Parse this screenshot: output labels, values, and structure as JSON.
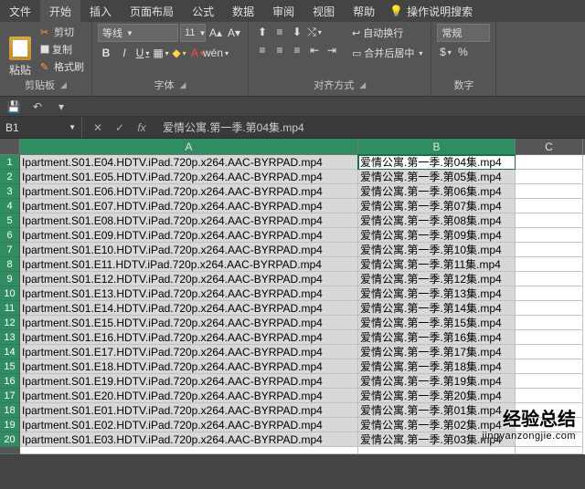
{
  "tabs": {
    "file": "文件",
    "home": "开始",
    "insert": "插入",
    "layout": "页面布局",
    "formula": "公式",
    "data": "数据",
    "review": "审阅",
    "view": "视图",
    "help": "帮助",
    "tell_me": "操作说明搜索"
  },
  "clipboard": {
    "paste": "粘贴",
    "cut": "剪切",
    "copy": "复制",
    "format_painter": "格式刷",
    "group_label": "剪贴板"
  },
  "font": {
    "name": "等线",
    "size": "11",
    "group_label": "字体",
    "wen": "wén"
  },
  "alignment": {
    "wrap": "自动换行",
    "merge": "合并后居中",
    "group_label": "对齐方式"
  },
  "number": {
    "format": "常规",
    "group_label": "数字"
  },
  "name_box": "B1",
  "formula_value": "爱情公寓.第一季.第04集.mp4",
  "columns": {
    "A": "A",
    "B": "B",
    "C": "C"
  },
  "rows": [
    {
      "n": "1",
      "a": "Ipartment.S01.E04.HDTV.iPad.720p.x264.AAC-BYRPAD.mp4",
      "b": "爱情公寓.第一季.第04集.mp4"
    },
    {
      "n": "2",
      "a": "Ipartment.S01.E05.HDTV.iPad.720p.x264.AAC-BYRPAD.mp4",
      "b": "爱情公寓.第一季.第05集.mp4"
    },
    {
      "n": "3",
      "a": "Ipartment.S01.E06.HDTV.iPad.720p.x264.AAC-BYRPAD.mp4",
      "b": "爱情公寓.第一季.第06集.mp4"
    },
    {
      "n": "4",
      "a": "Ipartment.S01.E07.HDTV.iPad.720p.x264.AAC-BYRPAD.mp4",
      "b": "爱情公寓.第一季.第07集.mp4"
    },
    {
      "n": "5",
      "a": "Ipartment.S01.E08.HDTV.iPad.720p.x264.AAC-BYRPAD.mp4",
      "b": "爱情公寓.第一季.第08集.mp4"
    },
    {
      "n": "6",
      "a": "Ipartment.S01.E09.HDTV.iPad.720p.x264.AAC-BYRPAD.mp4",
      "b": "爱情公寓.第一季.第09集.mp4"
    },
    {
      "n": "7",
      "a": "Ipartment.S01.E10.HDTV.iPad.720p.x264.AAC-BYRPAD.mp4",
      "b": "爱情公寓.第一季.第10集.mp4"
    },
    {
      "n": "8",
      "a": "Ipartment.S01.E11.HDTV.iPad.720p.x264.AAC-BYRPAD.mp4",
      "b": "爱情公寓.第一季.第11集.mp4"
    },
    {
      "n": "9",
      "a": "Ipartment.S01.E12.HDTV.iPad.720p.x264.AAC-BYRPAD.mp4",
      "b": "爱情公寓.第一季.第12集.mp4"
    },
    {
      "n": "10",
      "a": "Ipartment.S01.E13.HDTV.iPad.720p.x264.AAC-BYRPAD.mp4",
      "b": "爱情公寓.第一季.第13集.mp4"
    },
    {
      "n": "11",
      "a": "Ipartment.S01.E14.HDTV.iPad.720p.x264.AAC-BYRPAD.mp4",
      "b": "爱情公寓.第一季.第14集.mp4"
    },
    {
      "n": "12",
      "a": "Ipartment.S01.E15.HDTV.iPad.720p.x264.AAC-BYRPAD.mp4",
      "b": "爱情公寓.第一季.第15集.mp4"
    },
    {
      "n": "13",
      "a": "Ipartment.S01.E16.HDTV.iPad.720p.x264.AAC-BYRPAD.mp4",
      "b": "爱情公寓.第一季.第16集.mp4"
    },
    {
      "n": "14",
      "a": "Ipartment.S01.E17.HDTV.iPad.720p.x264.AAC-BYRPAD.mp4",
      "b": "爱情公寓.第一季.第17集.mp4"
    },
    {
      "n": "15",
      "a": "Ipartment.S01.E18.HDTV.iPad.720p.x264.AAC-BYRPAD.mp4",
      "b": "爱情公寓.第一季.第18集.mp4"
    },
    {
      "n": "16",
      "a": "Ipartment.S01.E19.HDTV.iPad.720p.x264.AAC-BYRPAD.mp4",
      "b": "爱情公寓.第一季.第19集.mp4"
    },
    {
      "n": "17",
      "a": "Ipartment.S01.E20.HDTV.iPad.720p.x264.AAC-BYRPAD.mp4",
      "b": "爱情公寓.第一季.第20集.mp4"
    },
    {
      "n": "18",
      "a": "Ipartment.S01.E01.HDTV.iPad.720p.x264.AAC-BYRPAD.mp4",
      "b": "爱情公寓.第一季.第01集.mp4"
    },
    {
      "n": "19",
      "a": "Ipartment.S01.E02.HDTV.iPad.720p.x264.AAC-BYRPAD.mp4",
      "b": "爱情公寓.第一季.第02集.mp4"
    },
    {
      "n": "20",
      "a": "Ipartment.S01.E03.HDTV.iPad.720p.x264.AAC-BYRPAD.mp4",
      "b": "爱情公寓.第一季.第03集.mp4"
    }
  ],
  "watermark": {
    "title": "经验总结",
    "url": "jingyanzongjie.com"
  }
}
